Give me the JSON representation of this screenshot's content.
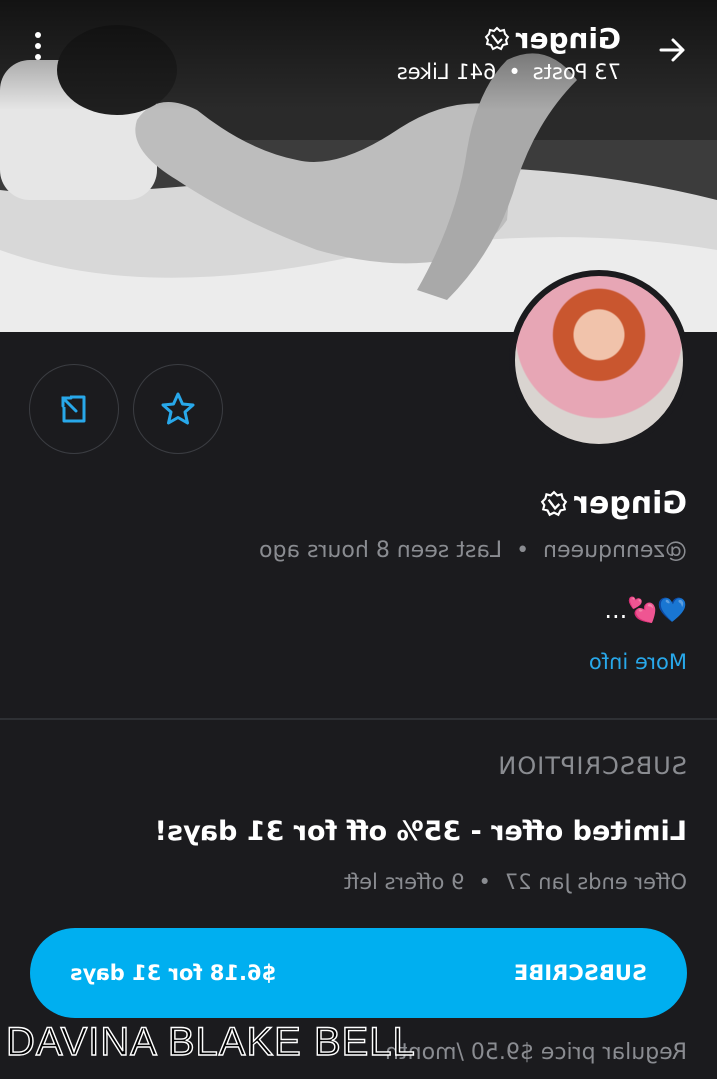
{
  "header": {
    "name": "Ginger",
    "posts": "73 Posts",
    "likes": "641 Likes",
    "separator": "•"
  },
  "profile": {
    "name": "Ginger",
    "handle": "@zennqueen",
    "last_seen": "Last seen 8 hours ago",
    "separator": "•",
    "bio": "💙💕...",
    "more_info": "More info"
  },
  "subscription": {
    "heading": "SUBSCRIPTION",
    "offer_title": "Limited offer - 35% off for 31 days!",
    "offer_ends": "Offer ends Jan 27",
    "offers_left": "9 offers left",
    "separator": "•",
    "button_label": "SUBSCRIBE",
    "button_price": "$6.18 for 31 days",
    "regular_price": "Regular price $9.50 /month"
  },
  "watermark": "DAVINA BLAKE BELL",
  "colors": {
    "accent": "#00aff0",
    "link": "#28a8ea",
    "background": "#1b1b1e",
    "muted_text": "#8a8c91"
  },
  "icons": {
    "back": "arrow-left-icon",
    "menu": "more-vertical-icon",
    "verified": "verified-badge-icon",
    "favorite": "star-icon",
    "share": "share-icon"
  }
}
